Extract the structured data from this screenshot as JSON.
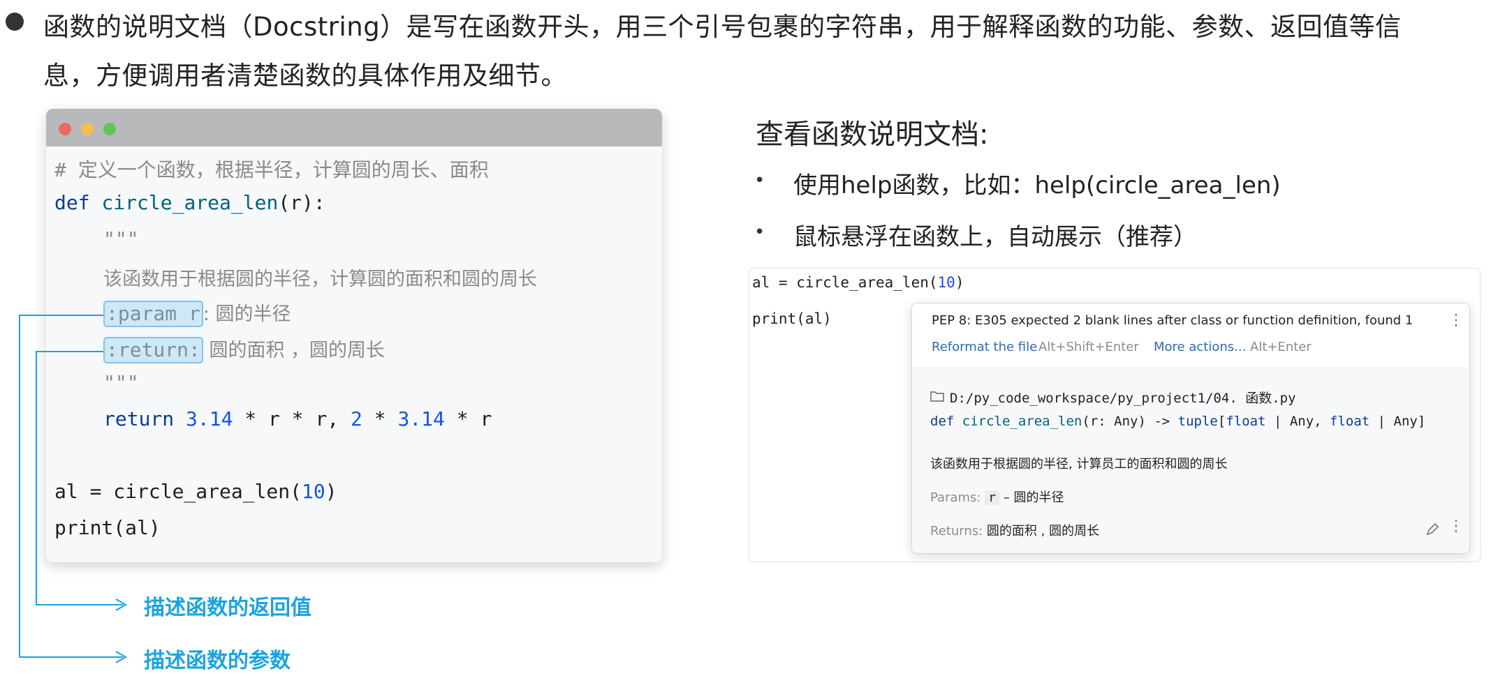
{
  "intro": {
    "line1": "函数的说明文档（Docstring）是写在函数开头，用三个引号包裹的字符串，用于解释函数的功能、参数、返回值等信",
    "line2": "息，方便调用者清楚函数的具体作用及细节。"
  },
  "code_card": {
    "comment": "# 定义一个函数，根据半径，计算圆的周长、面积",
    "def_kw": "def",
    "func_name": "circle_area_len",
    "def_sig": "(r):",
    "doc_open": "\"\"\"",
    "doc_desc": "该函数用于根据圆的半径，计算圆的面积和圆的周长",
    "param_tag": ":param r",
    "param_desc": ": 圆的半径",
    "return_tag": ":return:",
    "return_desc": " 圆的面积 ，圆的周长",
    "doc_close": "\"\"\"",
    "return_kw": "return",
    "expr_n1": "3.14",
    "expr_op1": " * r * r, ",
    "expr_n2": "2",
    "expr_op2": " * ",
    "expr_n3": "3.14",
    "expr_op3": " * r",
    "call_left": "al = circle_area_len(",
    "call_arg": "10",
    "call_right": ")",
    "print_line": "print(al)"
  },
  "annotations": {
    "return_label": "描述函数的返回值",
    "param_label": "描述函数的参数"
  },
  "right": {
    "heading": "查看函数说明文档:",
    "bullet_char": "•",
    "bullet1": "使用help函数，比如：help(circle_area_len)",
    "bullet2": "鼠标悬浮在函数上，自动展示（推荐）"
  },
  "ide": {
    "line1_left": "al = circle_area_len(",
    "line1_arg": "10",
    "line1_right": ")",
    "line2": "print(al)",
    "popup": {
      "warning": "PEP 8: E305 expected 2 blank lines after class or function definition, found 1",
      "menu_icon": "⋮",
      "reformat_link": "Reformat the file",
      "reformat_shortcut": "Alt+Shift+Enter",
      "more_link": "More actions...",
      "more_shortcut": "Alt+Enter",
      "file_path": "D:/py_code_workspace/py_project1/04. 函数.py",
      "sig_def": "def",
      "sig_name": "circle_area_len",
      "sig_rest_1": "(r: Any) -> ",
      "sig_tuple": "tuple",
      "sig_rest_2": "[",
      "sig_float1": "float",
      "sig_rest_3": " | Any, ",
      "sig_float2": "float",
      "sig_rest_4": " | Any]",
      "description": "该函数用于根据圆的半径, 计算员工的面积和圆的周长",
      "params_label": "Params:",
      "param_name": "r",
      "param_desc": "– 圆的半径",
      "returns_label": "Returns:",
      "returns_desc": "圆的面积 , 圆的周长"
    }
  },
  "colors": {
    "accent_blue": "#1aa3e0",
    "keyword": "#0b3d91",
    "number": "#1750eb"
  }
}
